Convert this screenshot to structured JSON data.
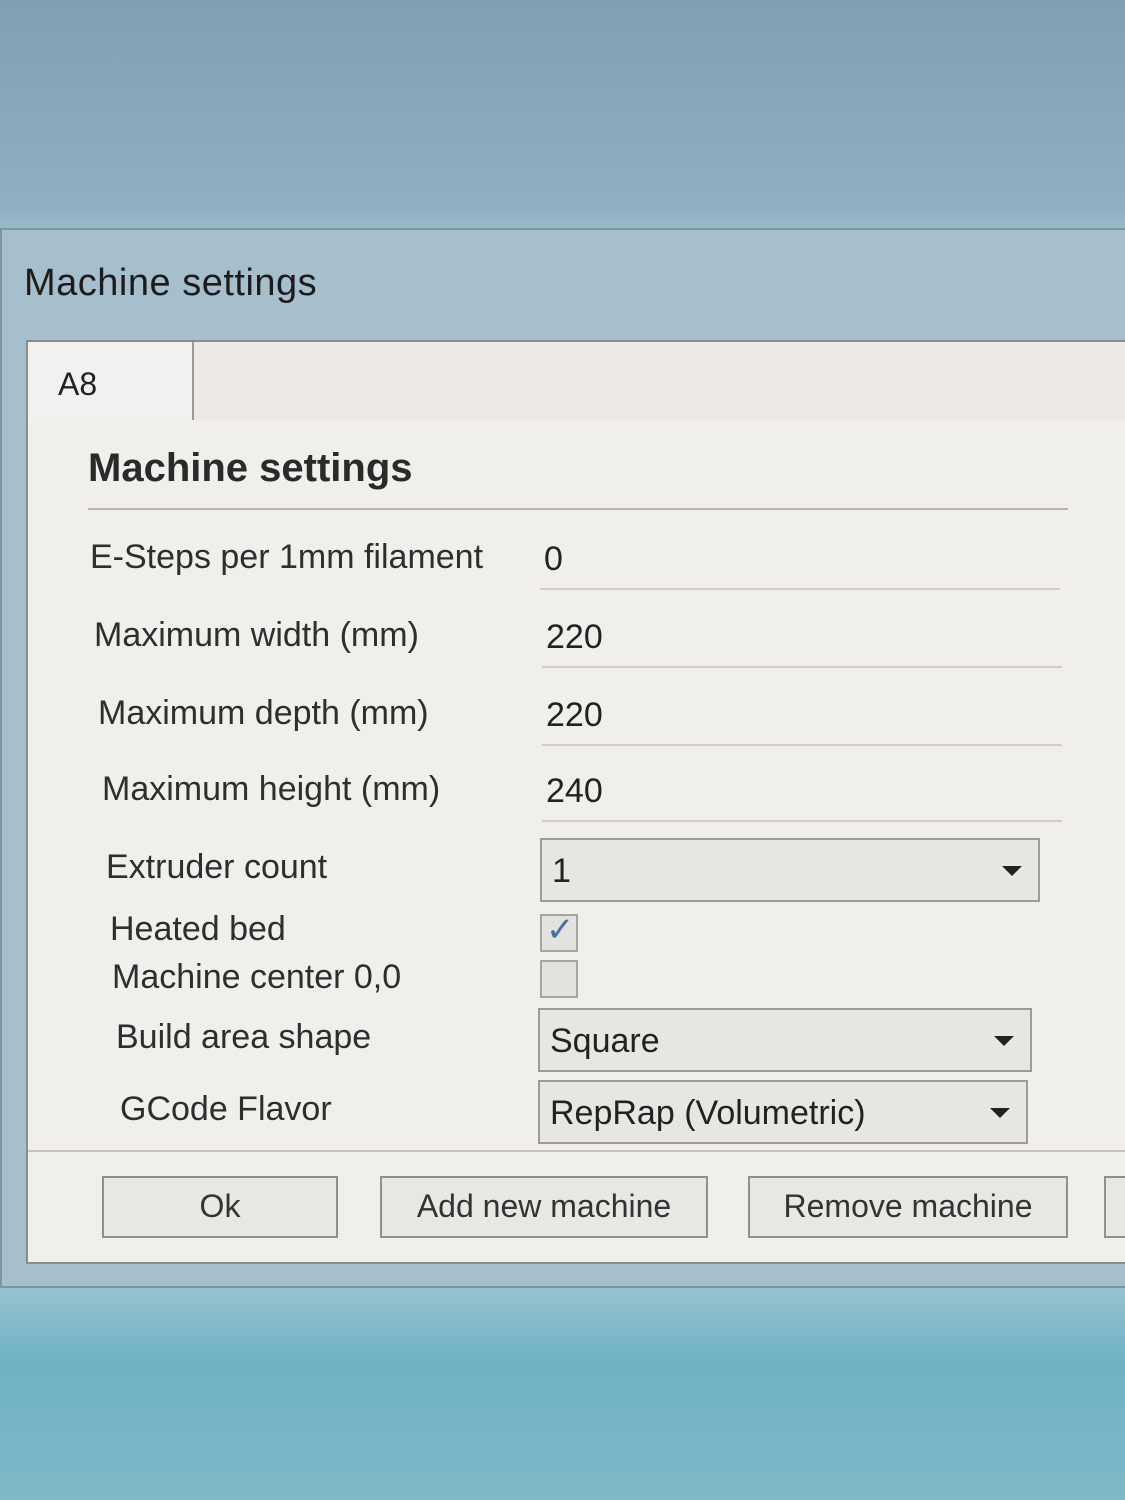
{
  "window": {
    "title": "Machine settings"
  },
  "tabs": [
    {
      "label": "A8"
    }
  ],
  "section": {
    "title": "Machine settings"
  },
  "fields": {
    "esteps": {
      "label": "E-Steps per 1mm filament",
      "value": "0"
    },
    "max_width": {
      "label": "Maximum width (mm)",
      "value": "220"
    },
    "max_depth": {
      "label": "Maximum depth (mm)",
      "value": "220"
    },
    "max_height": {
      "label": "Maximum height (mm)",
      "value": "240"
    },
    "extruder_count": {
      "label": "Extruder count",
      "value": "1"
    },
    "heated_bed": {
      "label": "Heated bed",
      "checked": true
    },
    "machine_center": {
      "label": "Machine center 0,0",
      "checked": false
    },
    "build_area_shape": {
      "label": "Build area shape",
      "value": "Square"
    },
    "gcode_flavor": {
      "label": "GCode Flavor",
      "value": "RepRap (Volumetric)"
    }
  },
  "buttons": {
    "ok": "Ok",
    "add_machine": "Add new machine",
    "remove_machine": "Remove machine"
  },
  "colors": {
    "dialog_bg": "#f1efec",
    "titlebar": "#a7bfcd",
    "check_accent": "#4a6fa5"
  }
}
